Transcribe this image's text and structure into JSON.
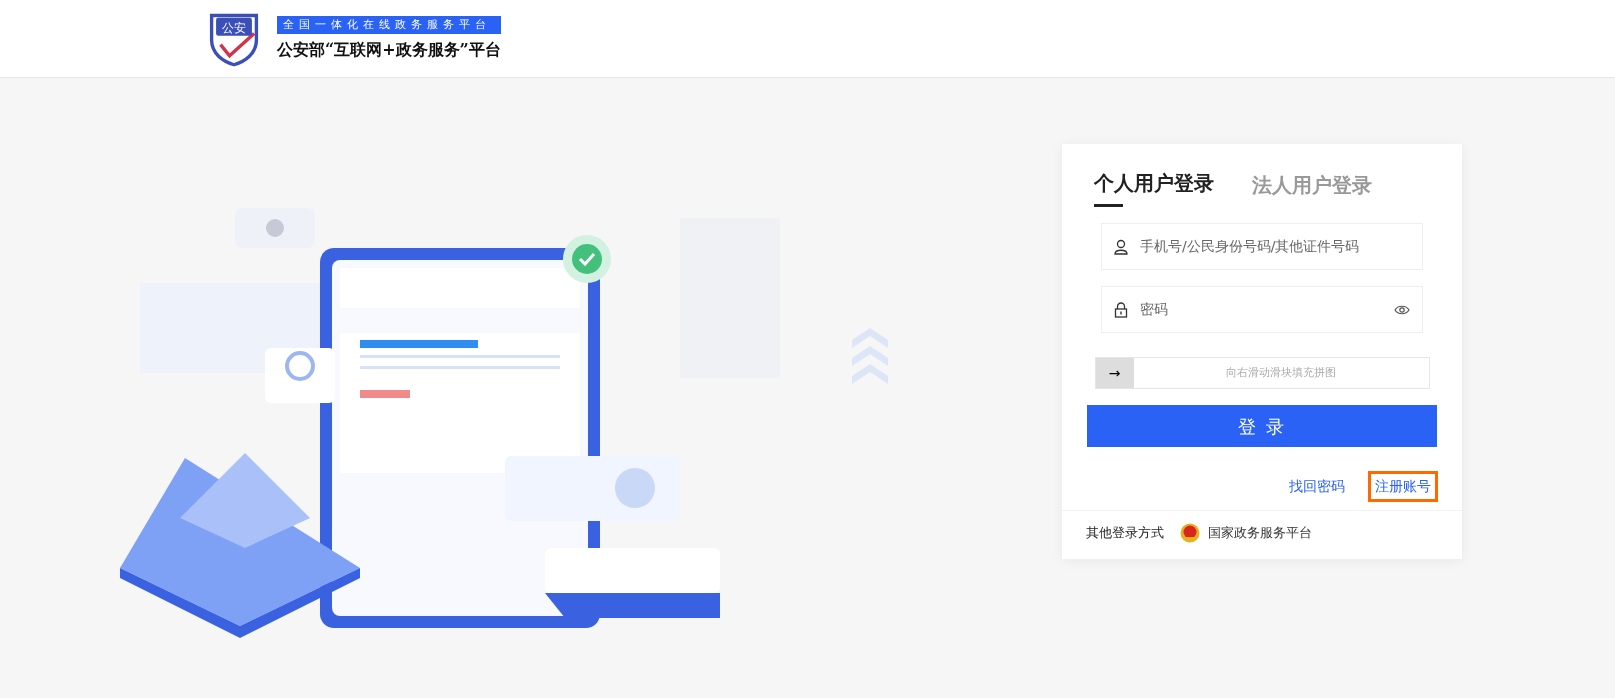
{
  "header": {
    "logo_badge": "公安",
    "slogan": "全国一体化在线政务服务平台",
    "title": "公安部“互联网+政务服务”平台"
  },
  "login": {
    "tabs": [
      {
        "label": "个人用户登录",
        "selected": true
      },
      {
        "label": "法人用户登录",
        "selected": false
      }
    ],
    "fields": [
      {
        "kind": "account",
        "placeholder": "手机号/公民身份号码/其他证件号码"
      },
      {
        "kind": "password",
        "placeholder": "密码"
      }
    ],
    "slider": {
      "handle": "→",
      "hint": "向右滑动滑块填充拼图"
    },
    "submit": "登 录",
    "links": [
      {
        "label": "找回密码",
        "highlighted": false
      },
      {
        "label": "注册账号",
        "highlighted": true
      }
    ],
    "other": {
      "label": "其他登录方式",
      "option": "国家政务服务平台"
    }
  }
}
